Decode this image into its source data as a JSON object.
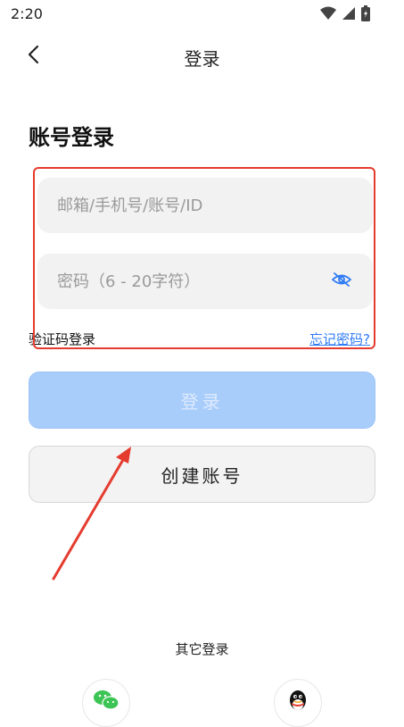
{
  "status_bar": {
    "time": "2:20",
    "icons": [
      "wifi-icon",
      "cellular-icon",
      "battery-icon"
    ]
  },
  "header": {
    "title": "登录",
    "back_icon": "chevron-left-icon"
  },
  "form": {
    "section_title": "账号登录",
    "account_placeholder": "邮箱/手机号/账号/ID",
    "account_value": "",
    "password_placeholder": "密码（6 - 20字符）",
    "password_value": "",
    "password_toggle_icon": "eye-hidden-icon",
    "code_login_label": "验证码登录",
    "forgot_password_label": "忘记密码?"
  },
  "buttons": {
    "login_label": "登录",
    "create_label": "创建账号"
  },
  "other": {
    "label": "其它登录",
    "providers": [
      {
        "icon": "wechat-icon"
      },
      {
        "icon": "qq-icon"
      }
    ]
  },
  "colors": {
    "accent_link": "#2f7bf5",
    "login_button": "#a9cdfb",
    "annotation_red": "#e53b2e",
    "eye_icon": "#2f7bf5"
  }
}
